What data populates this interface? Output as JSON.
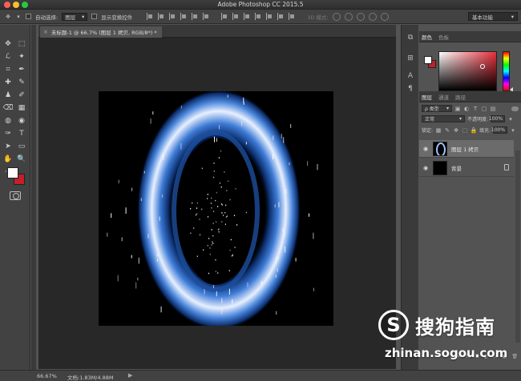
{
  "window": {
    "title": "Adobe Photoshop CC 2015.5"
  },
  "options_bar": {
    "auto_select_label": "自动选择:",
    "auto_select_value": "图层",
    "show_transform_label": "显示变换控件",
    "mode_3d_label": "3D 模式:",
    "workspace": "基本功能"
  },
  "document": {
    "tab_title": "未标题-1 @ 66.7% (图层 1 拷贝, RGB/8*) *",
    "close_glyph": "×"
  },
  "status": {
    "zoom": "66.67%",
    "doc_size": "文档:1.83M/4.88M",
    "arrow": "▶"
  },
  "color_panel": {
    "tabs": [
      "颜色",
      "色板"
    ],
    "foreground": "#ffffff",
    "background": "#c0212b"
  },
  "layers_panel": {
    "tabs": [
      "图层",
      "通道",
      "路径"
    ],
    "filter_label": "ρ 类型",
    "blend_mode": "正常",
    "opacity_label": "不透明度:",
    "opacity_value": "100%",
    "lock_label": "锁定:",
    "fill_label": "填充:",
    "fill_value": "100%",
    "layers": [
      {
        "name": "图层 1 拷贝",
        "selected": true
      },
      {
        "name": "背景",
        "selected": false
      }
    ],
    "footer": [
      "∞",
      "fx",
      "◘",
      "◐",
      "▭",
      "▣",
      "🗑"
    ]
  },
  "toolbar": {
    "tools": [
      "✥",
      "⬚",
      "ℒ",
      "✦",
      "⌗",
      "✒",
      "✚",
      "✎",
      "♟",
      "✐",
      "⌫",
      "▦",
      "◍",
      "◉",
      "✑",
      "T",
      "➤",
      "▭",
      "✋",
      "🔍",
      "···",
      ""
    ]
  },
  "watermark": {
    "logo_letter": "S",
    "brand_cn": "搜狗指南",
    "url": "zhinan.sogou.com"
  }
}
